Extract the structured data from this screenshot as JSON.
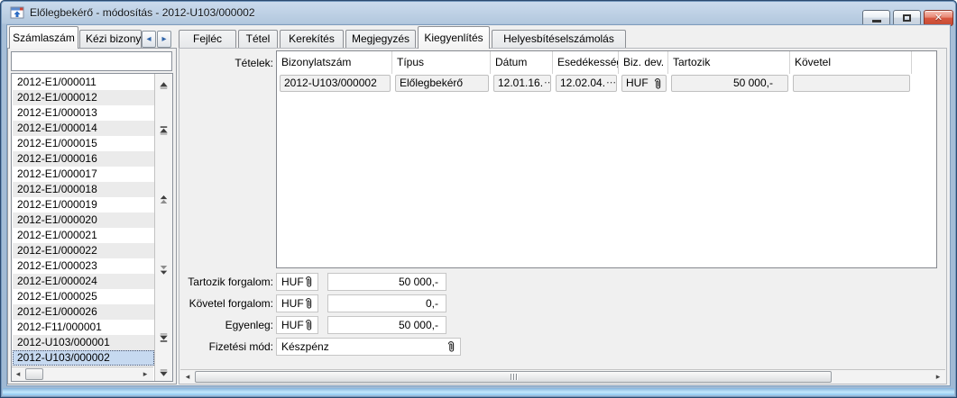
{
  "window": {
    "title": "Előlegbekérő - módosítás - 2012-U103/000002"
  },
  "icons": {
    "close": "✕",
    "ellipsis": "⋯",
    "arrow_left_small": "◂",
    "arrow_right_small": "▸"
  },
  "left_panel": {
    "tabs": [
      {
        "label": "Számlaszám",
        "active": true
      },
      {
        "label": "Kézi bizonyl",
        "active": false
      }
    ],
    "search": {
      "value": ""
    },
    "items": [
      "2012-E1/000011",
      "2012-E1/000012",
      "2012-E1/000013",
      "2012-E1/000014",
      "2012-E1/000015",
      "2012-E1/000016",
      "2012-E1/000017",
      "2012-E1/000018",
      "2012-E1/000019",
      "2012-E1/000020",
      "2012-E1/000021",
      "2012-E1/000022",
      "2012-E1/000023",
      "2012-E1/000024",
      "2012-E1/000025",
      "2012-E1/000026",
      "2012-F11/000001",
      "2012-U103/000001",
      "2012-U103/000002"
    ],
    "selected_item": "2012-U103/000002"
  },
  "right_panel": {
    "tabs": [
      {
        "label": "Fejléc",
        "active": false
      },
      {
        "label": "Tétel",
        "active": false
      },
      {
        "label": "Kerekítés",
        "active": false
      },
      {
        "label": "Megjegyzés",
        "active": false
      },
      {
        "label": "Kiegyenlítés",
        "active": true
      },
      {
        "label": "Helyesbítéselszámolás",
        "active": false
      }
    ],
    "items_label": "Tételek:",
    "table": {
      "columns": [
        "Bizonylatszám",
        "Típus",
        "Dátum",
        "Esedékesség",
        "Biz. dev.",
        "Tartozik",
        "Követel"
      ],
      "rows": [
        {
          "bizonylatszam": "2012-U103/000002",
          "tipus": "Előlegbekérő",
          "datum": "12.01.16.",
          "esedekesseg": "12.02.04.",
          "deviza": "HUF",
          "tartozik": "50 000,-",
          "kovetel": ""
        }
      ]
    },
    "summary": {
      "tartozik_forgalom": {
        "label": "Tartozik forgalom:",
        "currency": "HUF",
        "value": "50 000,-"
      },
      "kovetel_forgalom": {
        "label": "Követel forgalom:",
        "currency": "HUF",
        "value": "0,-"
      },
      "egyenleg": {
        "label": "Egyenleg:",
        "currency": "HUF",
        "value": "50 000,-"
      },
      "fizetesi_mod": {
        "label": "Fizetési mód:",
        "value": "Készpénz"
      }
    }
  }
}
